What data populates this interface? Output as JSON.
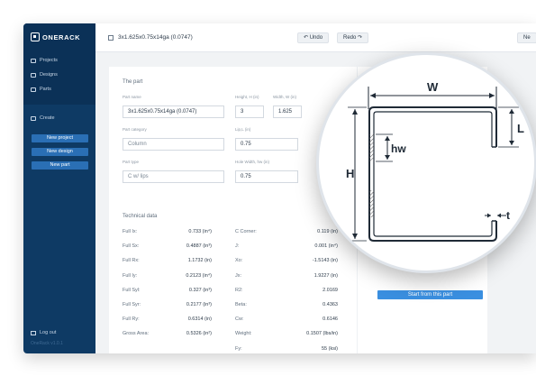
{
  "app": {
    "logo_text": "ONERACK",
    "version": "OneRack v1.0.1"
  },
  "sidebar": {
    "items": [
      {
        "label": "Projects",
        "icon": "folder-icon"
      },
      {
        "label": "Designs",
        "icon": "layers-icon"
      },
      {
        "label": "Parts",
        "icon": "grid-icon"
      }
    ],
    "create_label": "Create",
    "buttons": [
      "New project",
      "New design",
      "New part"
    ],
    "logout_label": "Log out"
  },
  "topbar": {
    "part_title": "3x1.625x0.75x14ga (0.0747)",
    "undo_label": "Undo",
    "redo_label": "Redo",
    "next_label": "Ne"
  },
  "part": {
    "section_title": "The part",
    "name_label": "Part name",
    "name_value": "3x1.625x0.75x14ga (0.0747)",
    "height_label": "Height, H (in)",
    "height_value": "3",
    "width_label": "Width, W (in)",
    "width_value": "1.625",
    "category_label": "Part category",
    "category_value": "Column",
    "lip_label": "Lip,L (in)",
    "lip_value": "0.75",
    "type_label": "Part type",
    "type_value": "C w/ lips",
    "hole_label": "Hole Width, hw (in)",
    "hole_value": "0.75"
  },
  "tech": {
    "section_title": "Technical data",
    "left": [
      {
        "label": "Full Ix:",
        "value": "0.733 (in⁴)"
      },
      {
        "label": "Full Sx:",
        "value": "0.4887 (in³)"
      },
      {
        "label": "Full Rx:",
        "value": "1.1732 (in)"
      },
      {
        "label": "Full Iy:",
        "value": "0.2123 (in⁴)"
      },
      {
        "label": "Full Syl:",
        "value": "0.327 (in³)"
      },
      {
        "label": "Full Syr:",
        "value": "0.2177 (in³)"
      },
      {
        "label": "Full Ry:",
        "value": "0.6314 (in)"
      },
      {
        "label": "Gross Area:",
        "value": "0.5326 (in²)"
      }
    ],
    "right": [
      {
        "label": "C Corner:",
        "value": "0.119 (in)"
      },
      {
        "label": "J:",
        "value": "0.001 (in⁴)"
      },
      {
        "label": "Xo:",
        "value": "-1.5143 (in)"
      },
      {
        "label": "Jx:",
        "value": "1.9227 (in)"
      },
      {
        "label": "R2:",
        "value": "2.0169"
      },
      {
        "label": "Beta:",
        "value": "0.4363"
      },
      {
        "label": "Cw:",
        "value": "0.6146"
      },
      {
        "label": "Weight:",
        "value": "0.1507 (lbs/in)"
      },
      {
        "label": "Fy:",
        "value": "55 (ksi)"
      }
    ]
  },
  "right_panel": {
    "start_button": "Start from this part"
  },
  "diagram": {
    "labels": {
      "W": "W",
      "H": "H",
      "L": "L",
      "hw": "hw",
      "t": "t"
    }
  },
  "colors": {
    "sidebar": "#0e3a64",
    "accent": "#3a8fe0",
    "button": "#2a6fb5"
  }
}
